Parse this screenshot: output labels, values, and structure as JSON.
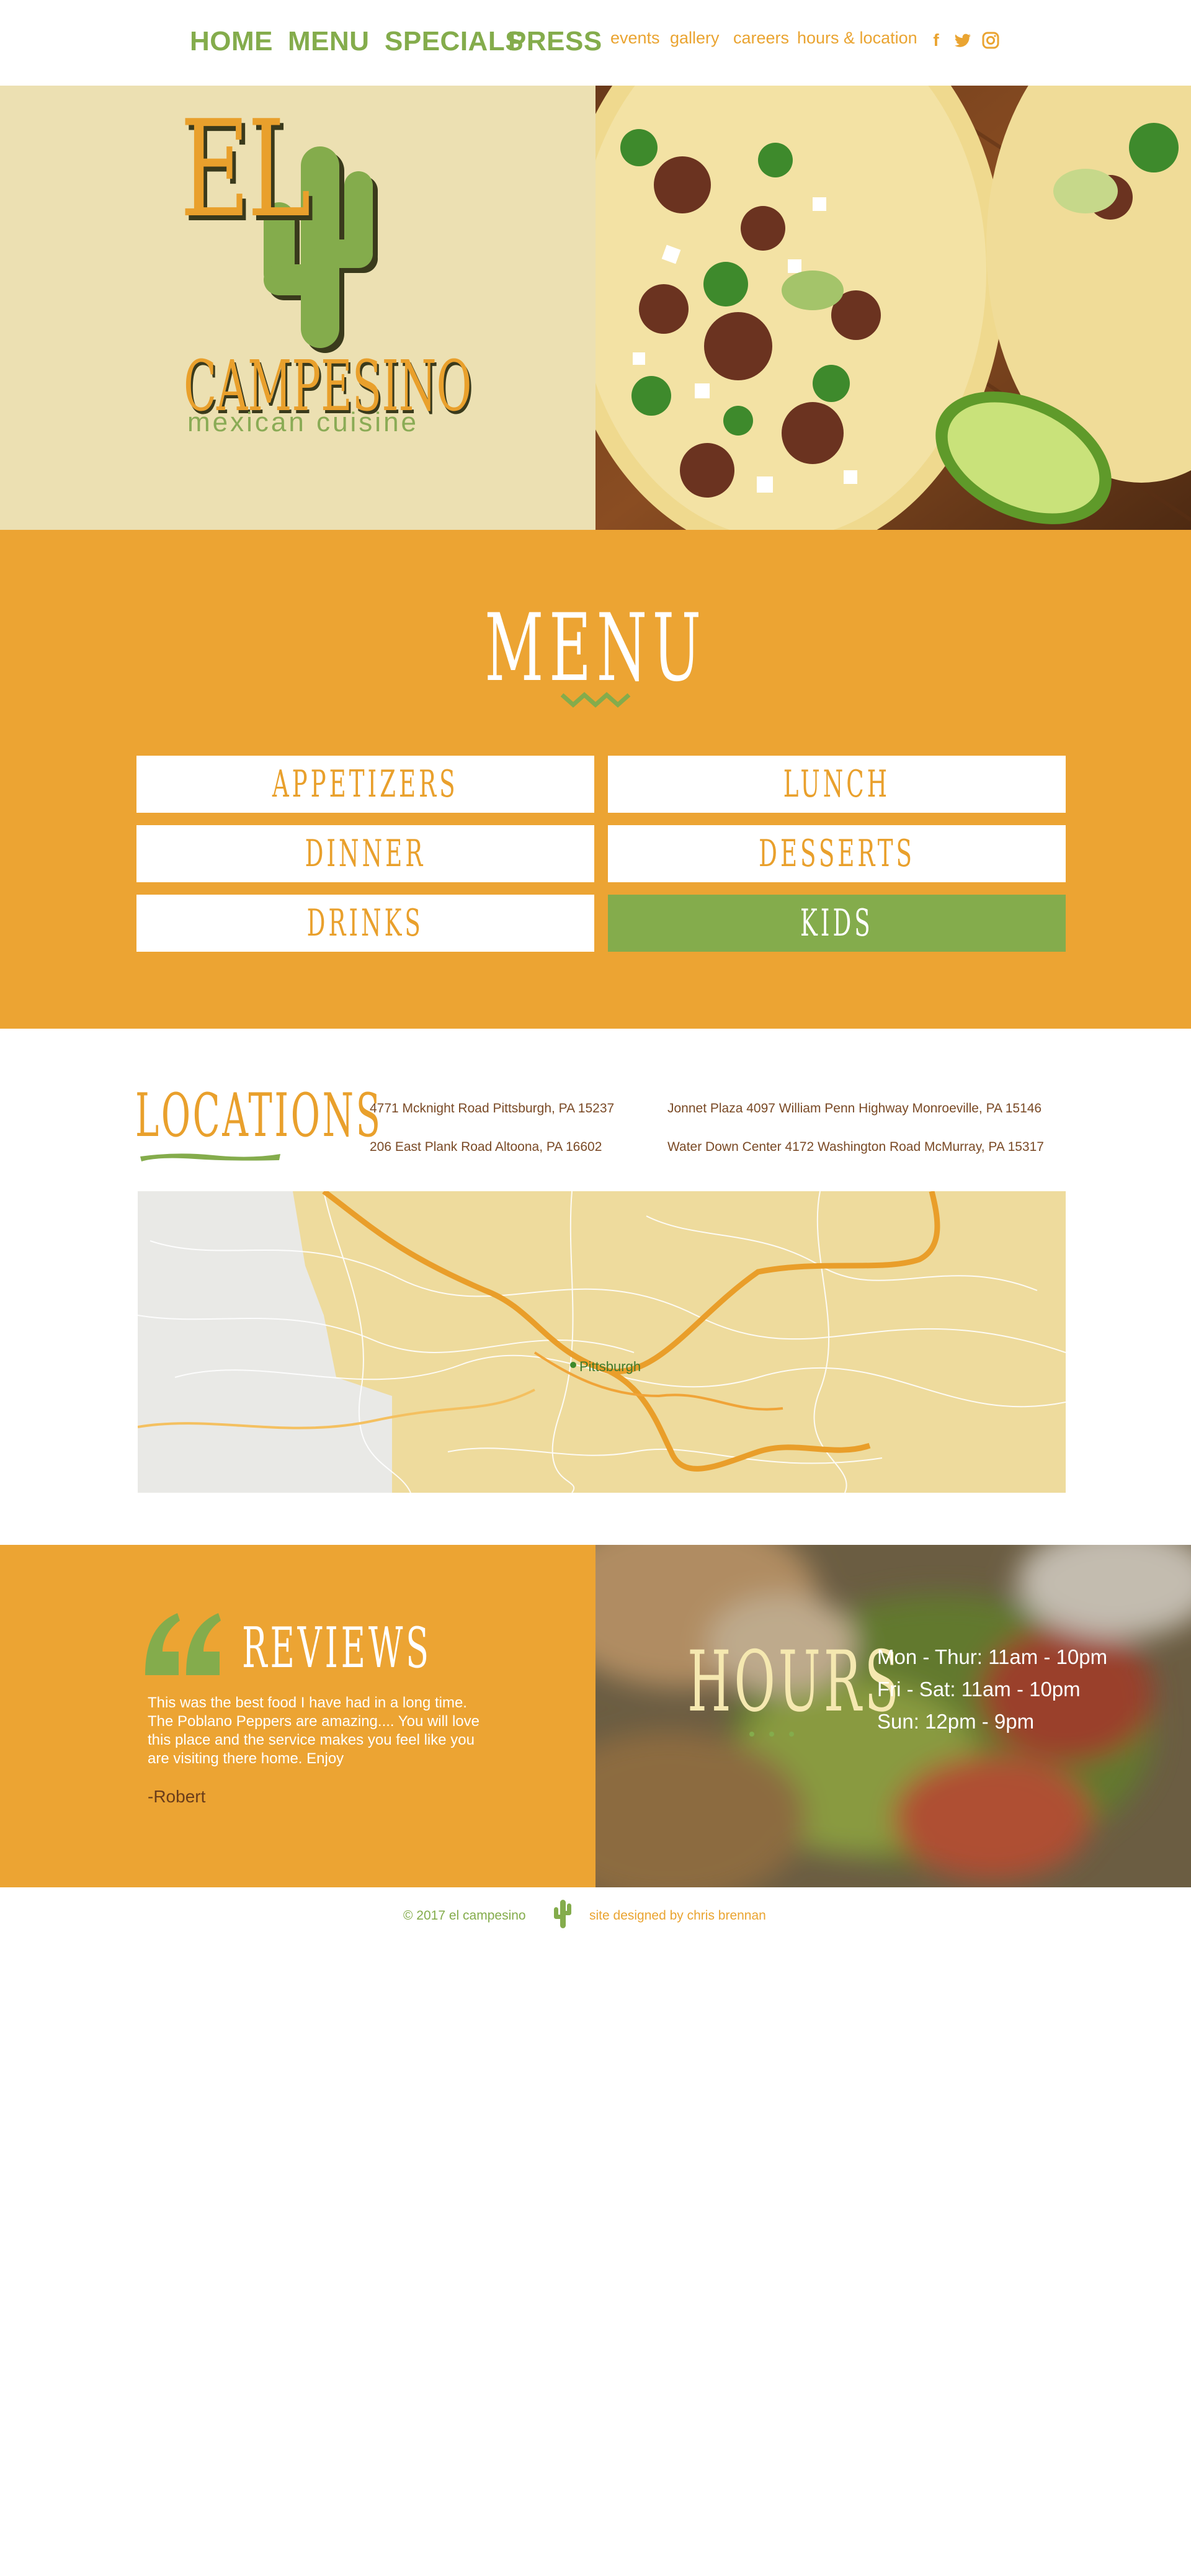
{
  "nav": {
    "main": [
      "HOME",
      "MENU",
      "SPECIALS",
      "PRESS"
    ],
    "sub": [
      "events",
      "gallery",
      "careers",
      "hours & location"
    ],
    "social": [
      "facebook-icon",
      "twitter-icon",
      "instagram-icon"
    ]
  },
  "logo": {
    "el": "EL",
    "name": "CAMPESINO",
    "tagline": "mexican cuisine"
  },
  "menu": {
    "title": "MENU",
    "items": [
      "APPETIZERS",
      "LUNCH",
      "DINNER",
      "DESSERTS",
      "DRINKS",
      "KIDS"
    ],
    "active": "KIDS"
  },
  "locations": {
    "title": "LOCATIONS",
    "addresses": [
      "4771 Mcknight Road Pittsburgh, PA 15237",
      "Jonnet Plaza 4097 William Penn Highway Monroeville, PA 15146",
      "206 East Plank Road Altoona, PA 16602",
      "Water Down Center 4172 Washington Road McMurray, PA 15317"
    ],
    "map_label": "Pittsburgh"
  },
  "reviews": {
    "title": "REVIEWS",
    "text": "This was the best food I have had in a long time. The Poblano Peppers are amazing.... You will love this place and the service makes you feel like you are visiting there home. Enjoy",
    "author": "-Robert"
  },
  "hours": {
    "title": "HOURS",
    "lines": [
      "Mon - Thur: 11am - 10pm",
      "Fri - Sat: 11am - 10pm",
      "Sun: 12pm - 9pm"
    ]
  },
  "footer": {
    "copyright": "© 2017 el campesino",
    "credit": "site designed by chris brennan"
  },
  "colors": {
    "green": "#84ac4c",
    "orange": "#eca433",
    "cream": "#ece0b2",
    "brown": "#7a4a26"
  }
}
